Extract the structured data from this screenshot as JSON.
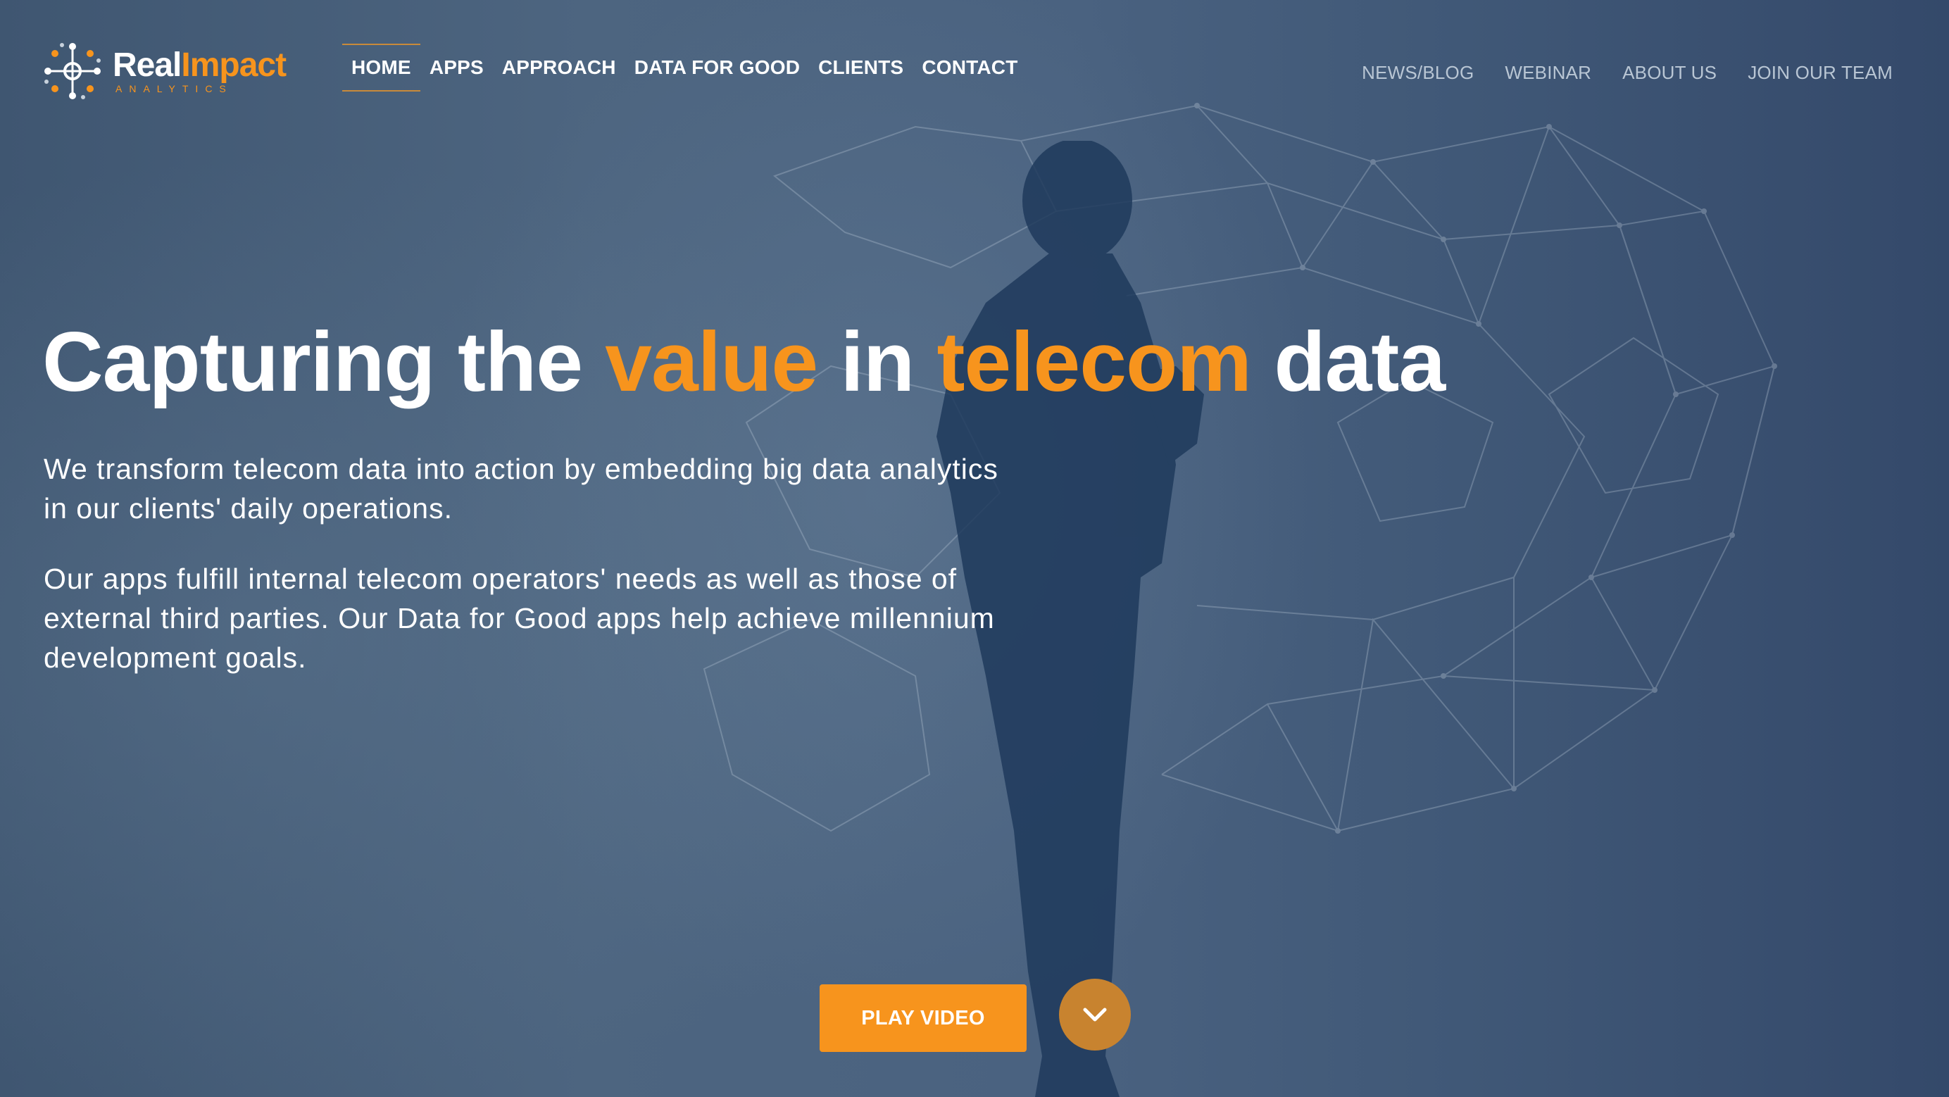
{
  "brand": {
    "name_part1": "Real",
    "name_part2": "Impact",
    "tagline": "ANALYTICS",
    "accent_color": "#f7941d"
  },
  "main_nav": {
    "items": [
      {
        "label": "HOME",
        "active": true
      },
      {
        "label": "APPS",
        "active": false
      },
      {
        "label": "APPROACH",
        "active": false
      },
      {
        "label": "DATA FOR GOOD",
        "active": false
      },
      {
        "label": "CLIENTS",
        "active": false
      },
      {
        "label": "CONTACT",
        "active": false
      }
    ]
  },
  "secondary_nav": {
    "items": [
      {
        "label": "NEWS/BLOG"
      },
      {
        "label": "WEBINAR"
      },
      {
        "label": "ABOUT US"
      },
      {
        "label": "JOIN OUR TEAM"
      }
    ]
  },
  "hero": {
    "headline": {
      "part1": "Capturing the ",
      "highlight1": "value",
      "part2": " in ",
      "highlight2": "telecom",
      "part3": " data"
    },
    "paragraphs": [
      "We transform telecom data into action by embedding big data analytics in our clients' daily operations.",
      "Our apps fulfill internal telecom operators' needs as well as those of external third parties. Our Data for Good apps help achieve millennium development goals."
    ],
    "cta_label": "PLAY VIDEO",
    "scroll_icon": "chevron-down-icon"
  }
}
